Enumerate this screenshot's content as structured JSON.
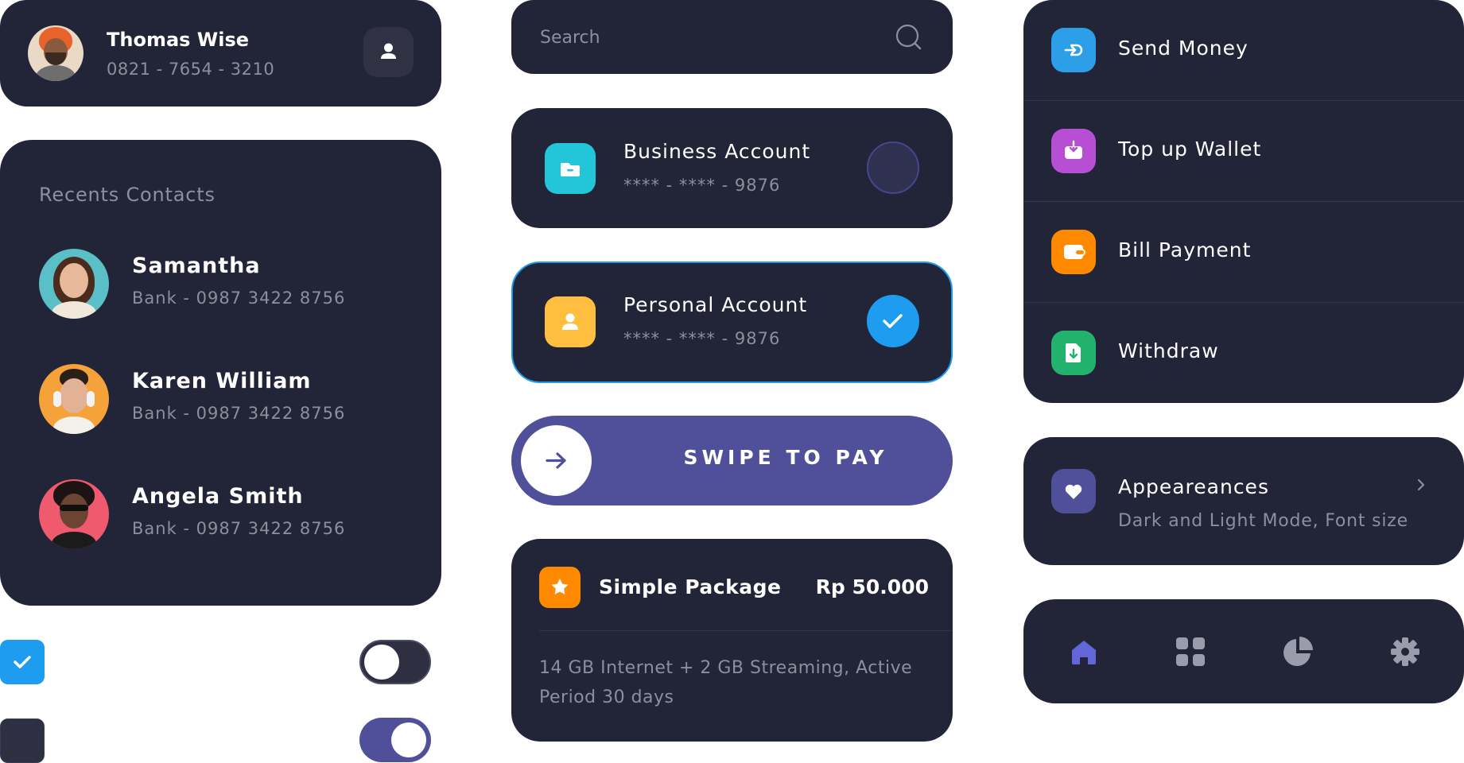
{
  "profile": {
    "name": "Thomas Wise",
    "phone": "0821 - 7654 - 3210",
    "icon": "user-icon"
  },
  "recents": {
    "title": "Recents Contacts",
    "contacts": [
      {
        "name": "Samantha",
        "bank": "Bank - 0987 3422 8756",
        "avatar_bg": "#5bbfc7"
      },
      {
        "name": "Karen William",
        "bank": "Bank - 0987 3422 8756",
        "avatar_bg": "#f6a23b"
      },
      {
        "name": "Angela Smith",
        "bank": "Bank - 0987 3422 8756",
        "avatar_bg": "#ef5a6e"
      }
    ]
  },
  "controls": {
    "checkbox_1_checked": true,
    "checkbox_2_checked": false,
    "toggle_1_on": false,
    "toggle_2_on": true
  },
  "search": {
    "placeholder": "Search",
    "icon": "search-icon"
  },
  "accounts": [
    {
      "name": "Business Account",
      "number": "**** - **** - 9876",
      "icon": "folder-icon",
      "color": "#22c6d8",
      "selected": false
    },
    {
      "name": "Personal Account",
      "number": "**** - **** - 9876",
      "icon": "user-icon",
      "color": "#ffbe3f",
      "selected": true
    }
  ],
  "swipe": {
    "label": "SWIPE TO PAY",
    "icon": "arrow-right-icon",
    "color": "#4f5099"
  },
  "package": {
    "name": "Simple Package",
    "price": "Rp 50.000",
    "description": "14 GB Internet + 2 GB Streaming, Active Period 30 days",
    "icon": "star-icon",
    "color": "#ff8a00"
  },
  "menu": {
    "items": [
      {
        "label": "Send Money",
        "icon": "send-icon",
        "color": "#2d9ee8"
      },
      {
        "label": "Top up Wallet",
        "icon": "download-icon",
        "color": "#b64fd3"
      },
      {
        "label": "Bill Payment",
        "icon": "wallet-icon",
        "color": "#ff8a00"
      },
      {
        "label": "Withdraw",
        "icon": "withdraw-icon",
        "color": "#23b16e"
      }
    ]
  },
  "appearances": {
    "title": "Appeareances",
    "subtitle": "Dark and Light Mode, Font size",
    "icon": "heart-icon"
  },
  "nav": {
    "items": [
      {
        "name": "home",
        "icon": "home-icon",
        "active": true
      },
      {
        "name": "apps",
        "icon": "grid-icon",
        "active": false
      },
      {
        "name": "stats",
        "icon": "pie-chart-icon",
        "active": false
      },
      {
        "name": "settings",
        "icon": "gear-icon",
        "active": false
      }
    ],
    "active_color": "#6366d9",
    "inactive_color": "#9a9cab"
  },
  "colors": {
    "card_bg": "#222437",
    "accent_blue": "#1e9cf0",
    "muted_text": "#8d8f9c"
  }
}
